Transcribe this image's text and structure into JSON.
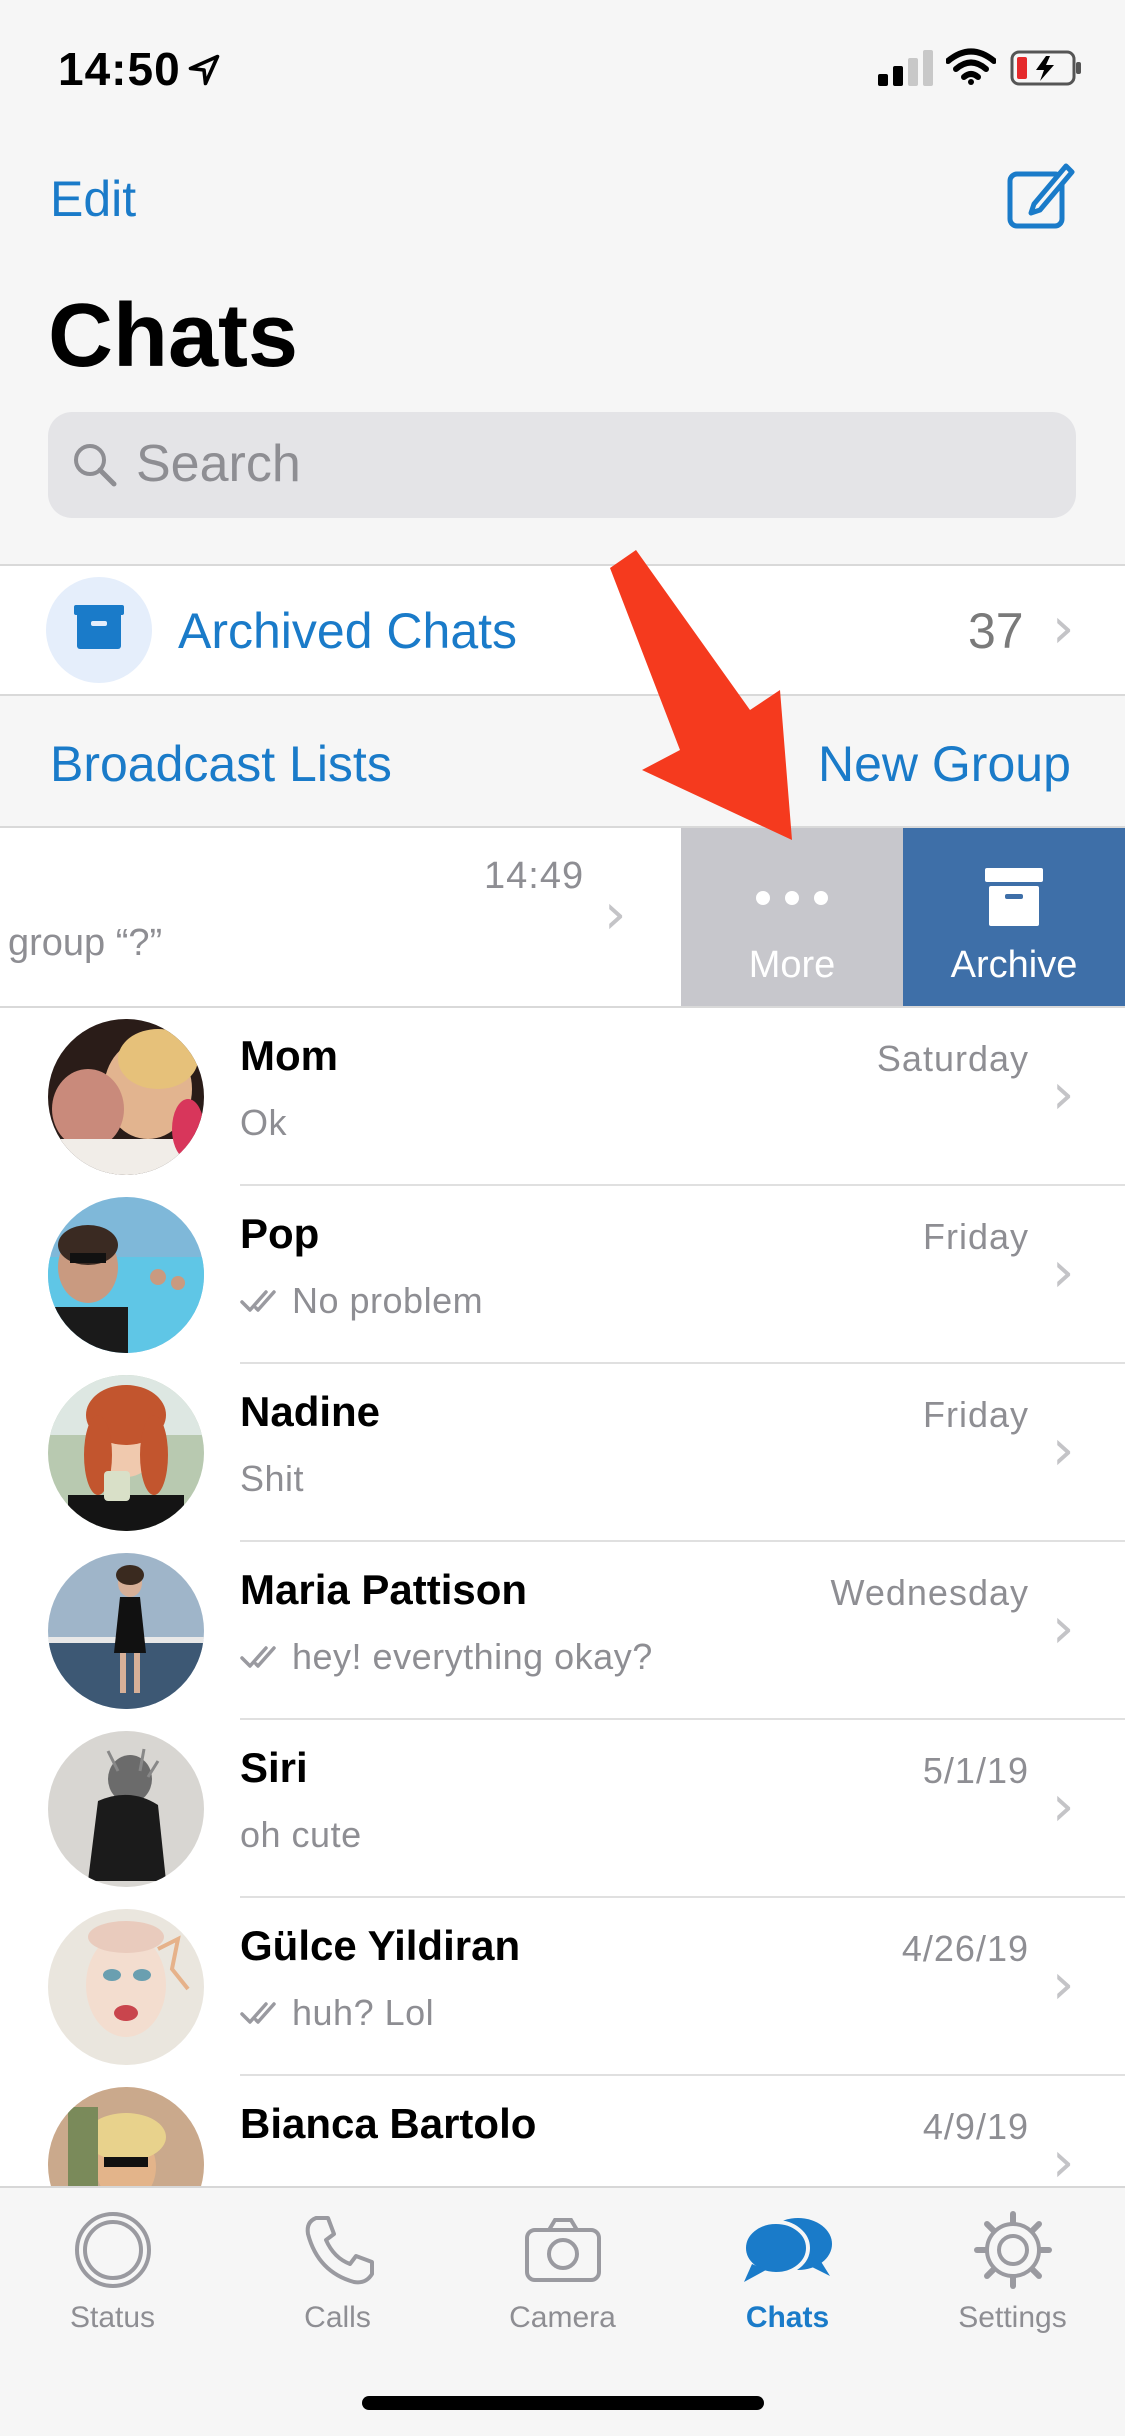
{
  "status_bar": {
    "time": "14:50"
  },
  "nav": {
    "edit_label": "Edit",
    "title": "Chats"
  },
  "search": {
    "placeholder": "Search"
  },
  "archived": {
    "label": "Archived Chats",
    "count": "37"
  },
  "links": {
    "broadcast": "Broadcast Lists",
    "new_group": "New Group"
  },
  "swiped_row": {
    "time": "14:49",
    "message": "group “?”",
    "more_label": "More",
    "archive_label": "Archive"
  },
  "chats": [
    {
      "name": "Mom",
      "date": "Saturday",
      "message": "Ok",
      "read": false
    },
    {
      "name": "Pop",
      "date": "Friday",
      "message": "No problem",
      "read": true
    },
    {
      "name": "Nadine",
      "date": "Friday",
      "message": "Shit",
      "read": false
    },
    {
      "name": "Maria Pattison",
      "date": "Wednesday",
      "message": "hey! everything okay?",
      "read": true
    },
    {
      "name": "Siri",
      "date": "5/1/19",
      "message": "oh cute",
      "read": false
    },
    {
      "name": "Gülce Yildiran",
      "date": "4/26/19",
      "message": "huh? Lol",
      "read": true
    },
    {
      "name": "Bianca Bartolo",
      "date": "4/9/19",
      "message": "",
      "read": true
    }
  ],
  "tabs": [
    {
      "label": "Status",
      "icon": "status-icon"
    },
    {
      "label": "Calls",
      "icon": "phone-icon"
    },
    {
      "label": "Camera",
      "icon": "camera-icon"
    },
    {
      "label": "Chats",
      "icon": "chats-icon",
      "active": true
    },
    {
      "label": "Settings",
      "icon": "gear-icon"
    }
  ],
  "colors": {
    "accent": "#1a7bc9",
    "archive_action": "#3e6fa8",
    "more_action": "#c7c7cc",
    "annotation_arrow": "#f53a1e"
  }
}
